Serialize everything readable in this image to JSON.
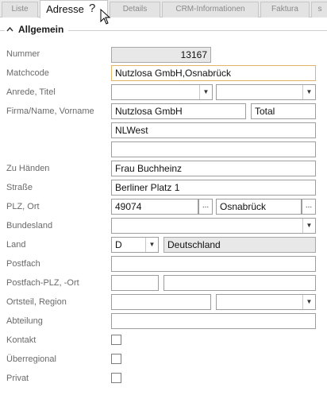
{
  "tabs": {
    "liste": "Liste",
    "adresse": "Adresse",
    "details": "Details",
    "crm": "CRM-Informationen",
    "faktura": "Faktura",
    "more": "s",
    "help_glyph": "?"
  },
  "section": {
    "title": "Allgemein",
    "collapse_icon": "^"
  },
  "labels": {
    "nummer": "Nummer",
    "matchcode": "Matchcode",
    "anrede": "Anrede, Titel",
    "firma": "Firma/Name, Vorname",
    "zu_haenden": "Zu Händen",
    "strasse": "Straße",
    "plz_ort": "PLZ, Ort",
    "bundesland": "Bundesland",
    "land": "Land",
    "postfach": "Postfach",
    "postfach_plz": "Postfach-PLZ, -Ort",
    "ortsteil": "Ortsteil, Region",
    "abteilung": "Abteilung",
    "kontakt": "Kontakt",
    "ueberregional": "Überregional",
    "privat": "Privat"
  },
  "values": {
    "nummer": "13167",
    "matchcode": "Nutzlosa GmbH,Osnabrück",
    "anrede": "",
    "titel": "",
    "firma": "Nutzlosa GmbH",
    "vorname": "Total",
    "name2": "NLWest",
    "name3": "",
    "zu_haenden": "Frau Buchheinz",
    "strasse": "Berliner Platz 1",
    "plz": "49074",
    "ort": "Osnabrück",
    "bundesland": "",
    "land_code": "D",
    "land_name": "Deutschland",
    "postfach": "",
    "postfach_plz": "",
    "postfach_ort": "",
    "ortsteil": "",
    "region": "",
    "abteilung": "",
    "kontakt": false,
    "ueberregional": false,
    "privat": false
  },
  "buttons": {
    "dots": "..."
  },
  "icons": {
    "dropdown": "▼"
  }
}
